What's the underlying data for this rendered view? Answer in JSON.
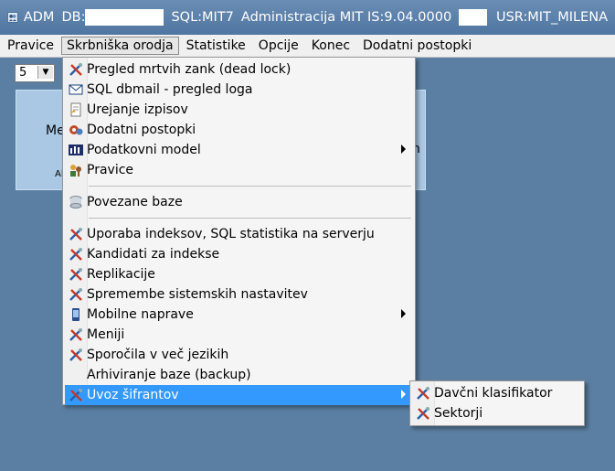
{
  "titlebar": {
    "app": "ADM",
    "db_label": "DB:",
    "sql": "SQL:MIT7",
    "admin": "Administracija MIT IS:9.04.0000",
    "user": "USR:MIT_MILENA"
  },
  "menubar": [
    "Pravice",
    "Skrbniška orodja",
    "Statistike",
    "Opcije",
    "Konec",
    "Dodatni postopki"
  ],
  "combo": {
    "value": "5"
  },
  "tiles": {
    "left_text": "Me",
    "left_small": "Al",
    "right_text": "n"
  },
  "menu": {
    "items": [
      {
        "label": "Pregled mrtvih zank (dead lock)",
        "icon": "tools-icon"
      },
      {
        "label": "SQL dbmail - pregled loga",
        "icon": "mail-log-icon"
      },
      {
        "label": "Urejanje izpisov",
        "icon": "document-icon"
      },
      {
        "label": "Dodatni postopki",
        "icon": "gear-globe-icon"
      },
      {
        "label": "Podatkovni model",
        "icon": "data-model-icon",
        "submenu": true
      },
      {
        "label": "Pravice",
        "icon": "users-key-icon"
      },
      {
        "label": "Povezane baze",
        "icon": "database-icon"
      },
      {
        "label": "Uporaba indeksov, SQL statistika na serverju",
        "icon": "tools-icon"
      },
      {
        "label": "Kandidati za indekse",
        "icon": "tools-icon"
      },
      {
        "label": "Replikacije",
        "icon": "tools-icon"
      },
      {
        "label": "Spremembe sistemskih nastavitev",
        "icon": "tools-icon"
      },
      {
        "label": "Mobilne naprave",
        "icon": "mobile-icon",
        "submenu": true
      },
      {
        "label": "Meniji",
        "icon": "tools-icon"
      },
      {
        "label": "Sporočila v več jezikih",
        "icon": "tools-icon"
      },
      {
        "label": "Arhiviranje baze (backup)",
        "icon": ""
      },
      {
        "label": "Uvoz šifrantov",
        "icon": "tools-icon",
        "submenu": true
      }
    ]
  },
  "submenu": {
    "items": [
      {
        "label": "Davčni klasifikator",
        "icon": "tools-icon"
      },
      {
        "label": "Sektorji",
        "icon": "tools-icon"
      }
    ]
  },
  "colors": {
    "highlight": "#3399ff",
    "desktop": "#5b7fa2",
    "titlebar": "#5a80aa"
  }
}
